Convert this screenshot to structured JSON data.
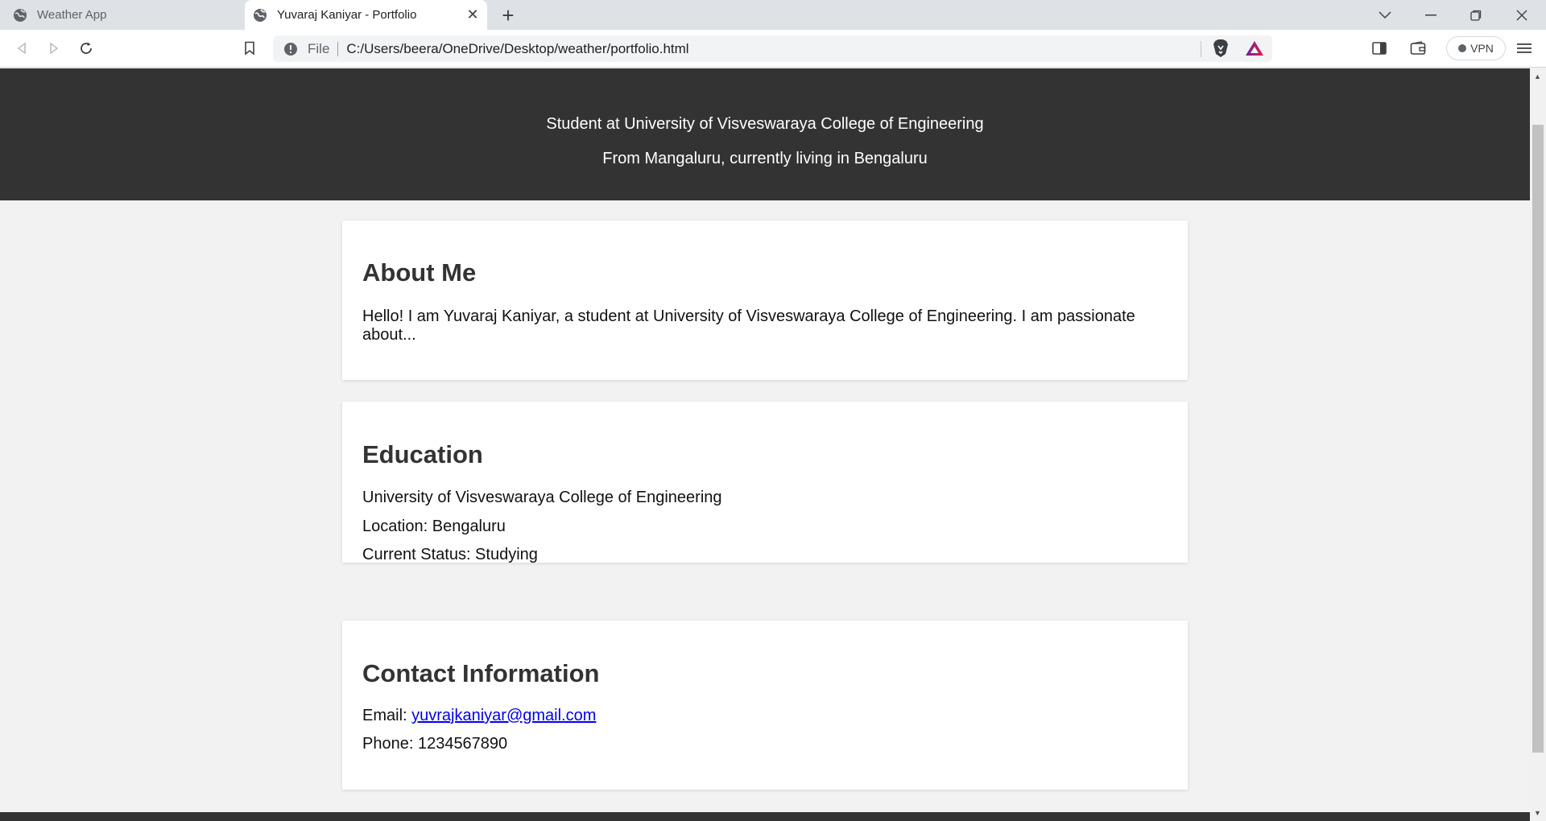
{
  "browser": {
    "tabs": [
      {
        "title": "Weather App",
        "active": false
      },
      {
        "title": "Yuvaraj Kaniyar - Portfolio",
        "active": true
      }
    ],
    "address": {
      "scheme": "File",
      "url": "C:/Users/beera/OneDrive/Desktop/weather/portfolio.html"
    },
    "vpn_label": "VPN"
  },
  "hero": {
    "line1": "Student at University of Visveswaraya College of Engineering",
    "line2": "From Mangaluru, currently living in Bengaluru"
  },
  "about": {
    "heading": "About Me",
    "text": "Hello! I am Yuvaraj Kaniyar, a student at University of Visveswaraya College of Engineering. I am passionate about..."
  },
  "education": {
    "heading": "Education",
    "institution": "University of Visveswaraya College of Engineering",
    "location": "Location: Bengaluru",
    "status": "Current Status: Studying"
  },
  "contact": {
    "heading": "Contact Information",
    "email_label": "Email: ",
    "email": "yuvrajkaniyar@gmail.com",
    "phone": "Phone: 1234567890"
  },
  "colors": {
    "header_bg": "#333333",
    "page_bg": "#f2f2f2",
    "link": "#0000ee"
  }
}
